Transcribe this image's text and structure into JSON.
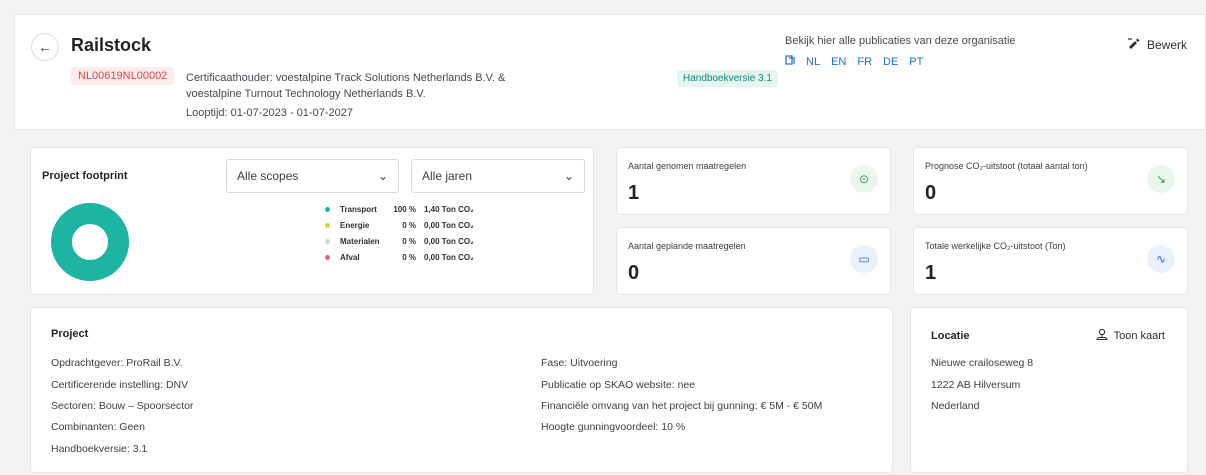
{
  "header": {
    "title": "Railstock",
    "certificate_id": "NL00619NL00002",
    "holder_line1": "Certificaathouder: voestalpine Track Solutions Netherlands B.V. &",
    "holder_line2": "voestalpine Turnout Technology Netherlands B.V.",
    "term": "Looptijd: 01-07-2023 - 01-07-2027",
    "handbook_badge": "Handboekversie 3.1",
    "publications_text": "Bekijk hier alle publicaties van deze organisatie",
    "languages": [
      "NL",
      "EN",
      "FR",
      "DE",
      "PT"
    ],
    "edit_label": "Bewerk"
  },
  "footprint": {
    "title": "Project footprint",
    "scope_select": "Alle scopes",
    "year_select": "Alle jaren",
    "legend": [
      {
        "name": "Transport",
        "pct": "100 %",
        "value": "1,40 Ton CO₂",
        "color": "#1db4a2"
      },
      {
        "name": "Energie",
        "pct": "0 %",
        "value": "0,00 Ton CO₂",
        "color": "#f4c542"
      },
      {
        "name": "Materialen",
        "pct": "0 %",
        "value": "0,00 Ton CO₂",
        "color": "#c9d6e8"
      },
      {
        "name": "Afval",
        "pct": "0 %",
        "value": "0,00 Ton CO₂",
        "color": "#ec6b5e"
      }
    ]
  },
  "stats": {
    "measures_taken": {
      "label": "Aantal genomen maatregelen",
      "value": "1"
    },
    "measures_planned": {
      "label": "Aantal geplande maatregelen",
      "value": "0"
    },
    "forecast": {
      "label": "Prognose CO₂-uitstoot (totaal aantal ton)",
      "value": "0"
    },
    "actual": {
      "label": "Totale werkelijke CO₂-uitstoot (Ton)",
      "value": "1"
    }
  },
  "project": {
    "title": "Project",
    "client": "Opdrachtgever: ProRail B.V.",
    "cert_body": "Certificerende instelling: DNV",
    "sectors": "Sectoren: Bouw – Spoorsector",
    "combinations": "Combinanten: Geen",
    "handbook": "Handboekversie: 3.1",
    "phase": "Fase: Uitvoering",
    "publication": "Publicatie op SKAO website: nee",
    "financial": "Financiële omvang van het project bij gunning: € 5M - € 50M",
    "award_advantage": "Hoogte gunningvoordeel: 10 %"
  },
  "location": {
    "title": "Locatie",
    "map_button": "Toon kaart",
    "street": "Nieuwe crailoseweg 8",
    "city": "1222 AB Hilversum",
    "country": "Nederland"
  }
}
